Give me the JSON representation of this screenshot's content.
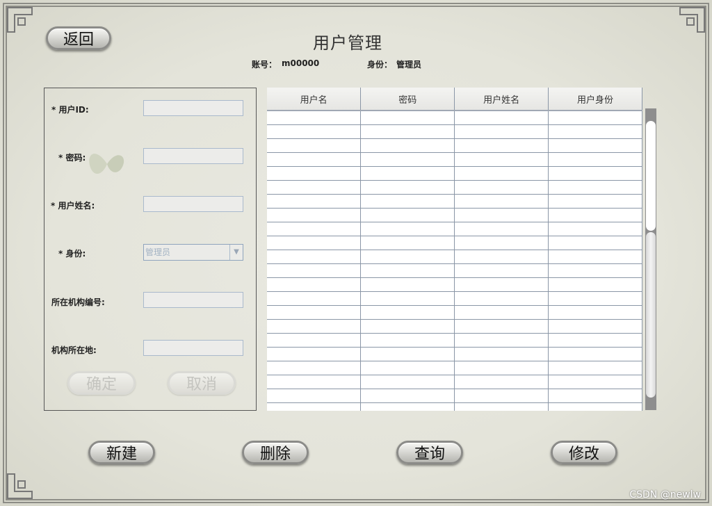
{
  "header": {
    "back_label": "返回",
    "title": "用户管理",
    "account_label": "账号：",
    "account_value": "m00000",
    "role_label": "身份：",
    "role_value": "管理员"
  },
  "form": {
    "user_id_label": "* 用户ID:",
    "password_label": "* 密码:",
    "user_name_label": "* 用户姓名:",
    "role_label": "* 身份:",
    "role_selected": "管理员",
    "org_no_label": "所在机构编号:",
    "org_location_label": "机构所在地:",
    "confirm_label": "确定",
    "cancel_label": "取消"
  },
  "table": {
    "columns": [
      "用户名",
      "密码",
      "用户姓名",
      "用户身份"
    ],
    "empty_rows": 22
  },
  "actions": {
    "new_label": "新建",
    "delete_label": "删除",
    "query_label": "查询",
    "modify_label": "修改"
  },
  "watermark": "CSDN @newlw"
}
